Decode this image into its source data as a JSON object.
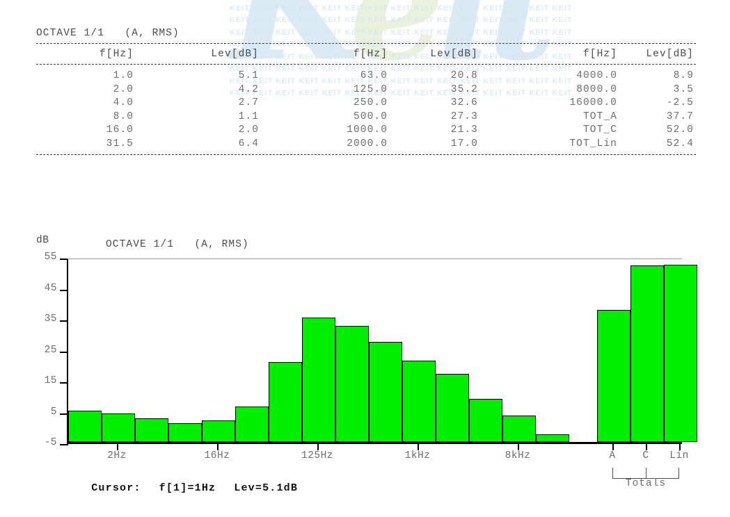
{
  "watermark": {
    "script_text": "Keit",
    "tile_text": "KEIT KEIT KEIT KEIT KEIT KEIT KEIT KEIT KEIT KEIT KEIT KEIT KEIT KEIT KEIT",
    "color": "#a8cde6"
  },
  "table": {
    "title": "OCTAVE 1/1   (A, RMS)",
    "headers": {
      "f1": "f[Hz]",
      "l1": "Lev[dB]",
      "f2": "f[Hz]",
      "l2": "Lev[dB]",
      "f3": "f[Hz]",
      "l3": "Lev[dB]"
    },
    "rows": [
      {
        "f1": "1.0",
        "l1": "5.1",
        "f2": "63.0",
        "l2": "20.8",
        "f3": "4000.0",
        "l3": "8.9"
      },
      {
        "f1": "2.0",
        "l1": "4.2",
        "f2": "125.0",
        "l2": "35.2",
        "f3": "8000.0",
        "l3": "3.5"
      },
      {
        "f1": "4.0",
        "l1": "2.7",
        "f2": "250.0",
        "l2": "32.6",
        "f3": "16000.0",
        "l3": "-2.5"
      },
      {
        "f1": "8.0",
        "l1": "1.1",
        "f2": "500.0",
        "l2": "27.3",
        "f3": "TOT_A",
        "l3": "37.7"
      },
      {
        "f1": "16.0",
        "l1": "2.0",
        "f2": "1000.0",
        "l2": "21.3",
        "f3": "TOT_C",
        "l3": "52.0"
      },
      {
        "f1": "31.5",
        "l1": "6.4",
        "f2": "2000.0",
        "l2": "17.0",
        "f3": "TOT_Lin",
        "l3": "52.4"
      }
    ]
  },
  "chart": {
    "title": "OCTAVE 1/1   (A, RMS)",
    "yaxis_unit": "dB",
    "totals_group_label": "Totals",
    "cursor": {
      "label": "Cursor:",
      "freq": "f[1]=1Hz",
      "level": "Lev=5.1dB"
    }
  },
  "chart_data": {
    "type": "bar",
    "title": "OCTAVE 1/1   (A, RMS)",
    "xlabel": "",
    "ylabel": "dB",
    "ylim": [
      -5,
      55
    ],
    "yticks": [
      55,
      45,
      35,
      25,
      15,
      5,
      -5
    ],
    "ytick_labels": [
      "55",
      "45",
      "35",
      "25",
      "15",
      "5",
      "-5"
    ],
    "grid": false,
    "legend": null,
    "bar_color": "#00f000",
    "bar_edge_color": "#000000",
    "categories": [
      "1.0",
      "2.0",
      "4.0",
      "8.0",
      "16.0",
      "31.5",
      "63.0",
      "125.0",
      "250.0",
      "500.0",
      "1000.0",
      "2000.0",
      "4000.0",
      "8000.0",
      "16000.0",
      "A",
      "C",
      "Lin"
    ],
    "values": [
      5.1,
      4.2,
      2.7,
      1.1,
      2.0,
      6.4,
      20.8,
      35.2,
      32.6,
      27.3,
      21.3,
      17.0,
      8.9,
      3.5,
      -2.5,
      37.7,
      52.0,
      52.4
    ],
    "xtick_labels": [
      "2Hz",
      "16Hz",
      "125Hz",
      "1kHz",
      "8kHz",
      "A",
      "C",
      "Lin"
    ],
    "xtick_categories": [
      "2.0",
      "16.0",
      "125.0",
      "1000.0",
      "8000.0",
      "A",
      "C",
      "Lin"
    ],
    "annotations": [
      "Totals"
    ]
  }
}
